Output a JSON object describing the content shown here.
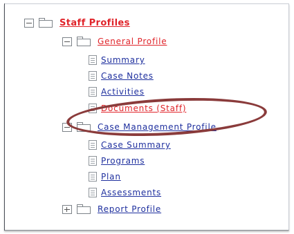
{
  "tree": {
    "root": {
      "label": "Staff Profiles",
      "expanded": true
    },
    "general_profile": {
      "label": "General Profile",
      "expanded": true,
      "items": [
        {
          "label": "Summary"
        },
        {
          "label": "Case Notes"
        },
        {
          "label": "Activities"
        },
        {
          "label": "Documents (Staff)",
          "selected": true
        }
      ]
    },
    "case_management_profile": {
      "label": "Case Management Profile",
      "expanded": true,
      "items": [
        {
          "label": "Case Summary"
        },
        {
          "label": "Programs"
        },
        {
          "label": "Plan"
        },
        {
          "label": "Assessments"
        }
      ]
    },
    "report_profile": {
      "label": "Report Profile",
      "expanded": false
    }
  },
  "annotation": {
    "color": "#8a3b3b"
  },
  "colors": {
    "link": "#1e2f9e",
    "active": "#e0242a"
  }
}
